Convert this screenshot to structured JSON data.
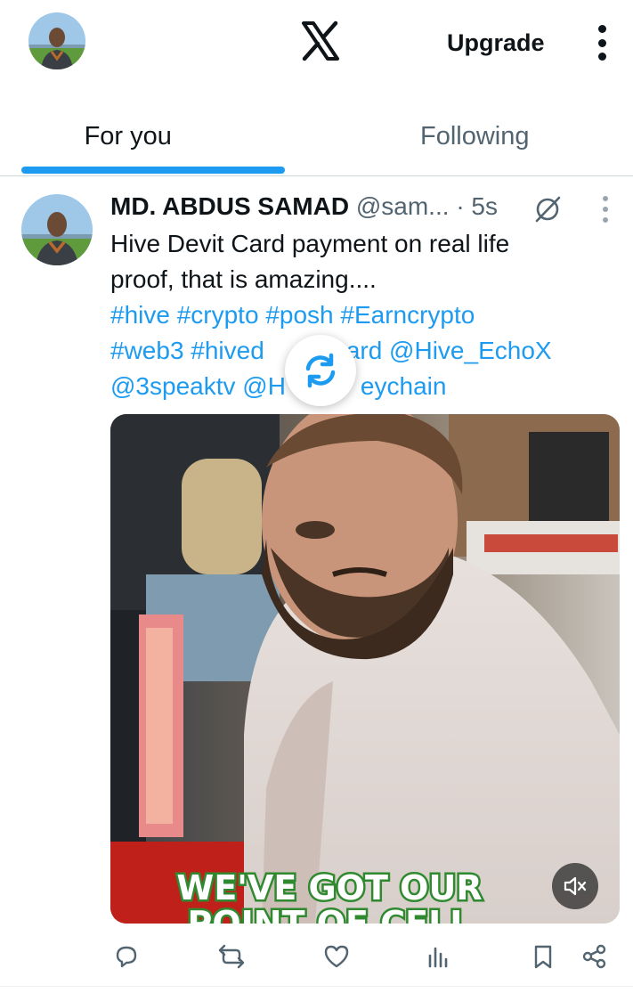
{
  "header": {
    "logo_icon": "x-logo-icon",
    "upgrade_label": "Upgrade",
    "more_icon": "more-vertical-icon"
  },
  "tabs": [
    {
      "label": "For you",
      "active": true
    },
    {
      "label": "Following",
      "active": false
    }
  ],
  "post": {
    "author_name": "MD. ABDUS SAMAD",
    "author_handle": "@sam...",
    "separator": "·",
    "time": "5s",
    "text_line1": "Hive Devit Card payment on real life",
    "text_line2": "proof, that is amazing....",
    "tags_line1": "#hive #crypto #posh #Earncrypto",
    "tags_line2": "#web3 #hived",
    "tags_line2_b": "ard @Hive_EchoX",
    "tags_line3": "@3speaktv @H",
    "tags_line3_b": "eychain",
    "media_caption_line1": "WE'VE GOT OUR",
    "media_caption_line2": "POINT OF CELL"
  },
  "actions": [
    {
      "name": "reply",
      "icon": "reply-icon"
    },
    {
      "name": "repost",
      "icon": "repost-icon"
    },
    {
      "name": "like",
      "icon": "heart-icon"
    },
    {
      "name": "views",
      "icon": "analytics-icon"
    },
    {
      "name": "bookmark",
      "icon": "bookmark-icon"
    },
    {
      "name": "share",
      "icon": "share-icon"
    }
  ],
  "colors": {
    "accent": "#1d9bf0",
    "text_primary": "#0f1419",
    "text_secondary": "#536471",
    "caption_outline": "#2f8a2f"
  }
}
